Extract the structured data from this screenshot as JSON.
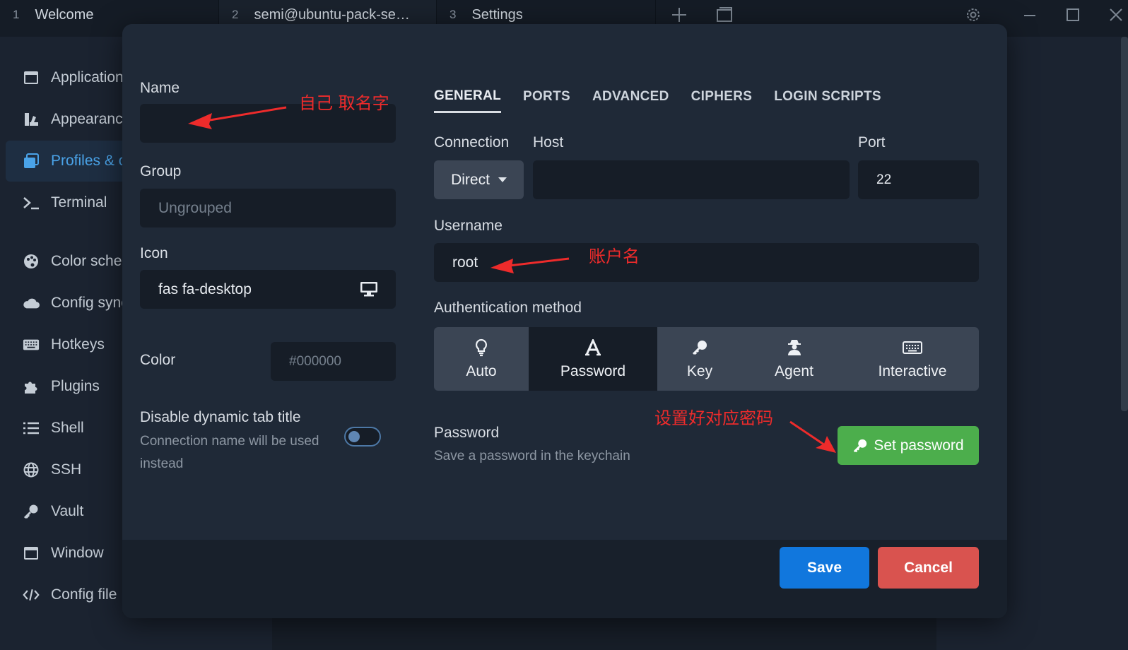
{
  "tabs": [
    {
      "num": "1",
      "label": "Welcome"
    },
    {
      "num": "2",
      "label": "semi@ubuntu-pack-se…"
    },
    {
      "num": "3",
      "label": "Settings"
    }
  ],
  "sidebar": {
    "items": [
      {
        "label": "Application",
        "icon": "window-icon"
      },
      {
        "label": "Appearance",
        "icon": "paint-icon"
      },
      {
        "label": "Profiles & c",
        "icon": "profiles-icon",
        "active": true
      },
      {
        "label": "Terminal",
        "icon": "terminal-icon"
      },
      {
        "label": "Color schen",
        "icon": "palette-icon"
      },
      {
        "label": "Config sync",
        "icon": "cloud-icon"
      },
      {
        "label": "Hotkeys",
        "icon": "keyboard-icon"
      },
      {
        "label": "Plugins",
        "icon": "puzzle-icon"
      },
      {
        "label": "Shell",
        "icon": "list-icon"
      },
      {
        "label": "SSH",
        "icon": "globe-icon"
      },
      {
        "label": "Vault",
        "icon": "key-icon"
      },
      {
        "label": "Window",
        "icon": "window-icon"
      },
      {
        "label": "Config file",
        "icon": "code-icon"
      }
    ]
  },
  "left_form": {
    "name_label": "Name",
    "name_value": "",
    "group_label": "Group",
    "group_placeholder": "Ungrouped",
    "icon_label": "Icon",
    "icon_value": "fas fa-desktop",
    "color_label": "Color",
    "color_placeholder": "#000000",
    "dynamic_title_label": "Disable dynamic tab title",
    "dynamic_title_desc_1": "Connection name will be used",
    "dynamic_title_desc_2": "instead",
    "dynamic_title_enabled": false
  },
  "content_tabs": [
    "GENERAL",
    "PORTS",
    "ADVANCED",
    "CIPHERS",
    "LOGIN SCRIPTS"
  ],
  "general": {
    "connection_label": "Connection",
    "connection_value": "Direct",
    "host_label": "Host",
    "host_value": "",
    "port_label": "Port",
    "port_value": "22",
    "username_label": "Username",
    "username_value": "root",
    "auth_label": "Authentication method",
    "auth_methods": [
      "Auto",
      "Password",
      "Key",
      "Agent",
      "Interactive"
    ],
    "auth_selected": "Password",
    "password_label": "Password",
    "password_desc": "Save a password in the keychain",
    "set_password_label": "Set password"
  },
  "footer": {
    "save_label": "Save",
    "cancel_label": "Cancel"
  },
  "annotations": {
    "name_note": "自己 取名字",
    "username_note": "账户名",
    "password_note": "设置好对应密码",
    "color": "#ee2b2b"
  },
  "colors": {
    "save": "#1177dd",
    "cancel": "#d9534f",
    "set_password": "#4cae4c",
    "active_sidebar": "#4aa3e8"
  }
}
